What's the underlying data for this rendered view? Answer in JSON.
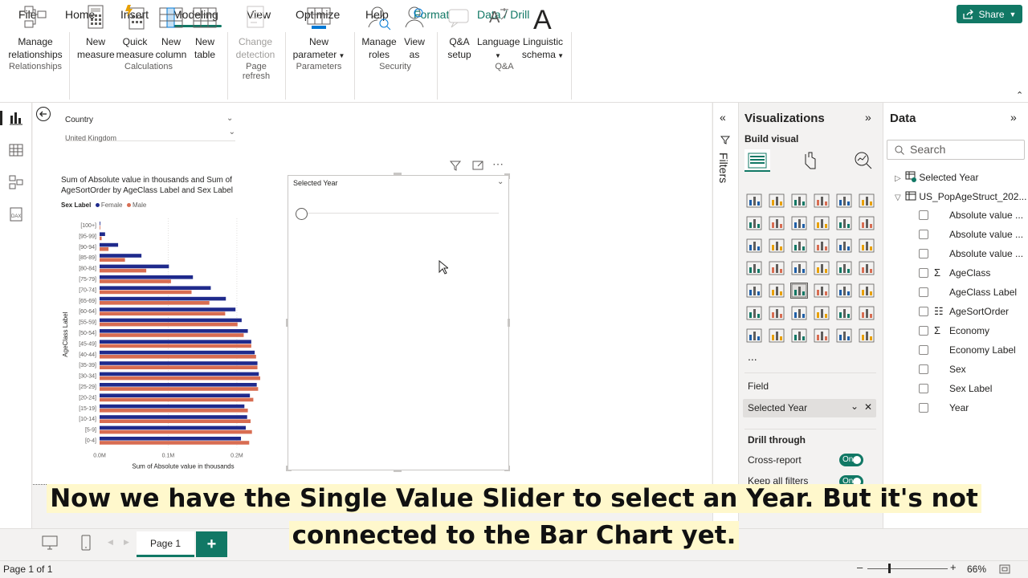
{
  "menu": {
    "items": [
      "File",
      "Home",
      "Insert",
      "Modeling",
      "View",
      "Optimize",
      "Help",
      "Format",
      "Data / Drill"
    ],
    "active": "Modeling",
    "share_label": "Share"
  },
  "ribbon": {
    "manage_relationships": "Manage relationships",
    "relationships_group": "Relationships",
    "new_measure": "New measure",
    "quick_measure": "Quick measure",
    "new_column": "New column",
    "new_table": "New table",
    "calculations_group": "Calculations",
    "change_detection": "Change detection",
    "page_refresh_group": "Page refresh",
    "new_parameter": "New parameter",
    "parameters_group": "Parameters",
    "manage_roles": "Manage roles",
    "view_as": "View as",
    "security_group": "Security",
    "qa_setup": "Q&A setup",
    "language": "Language",
    "linguistic_schema": "Linguistic schema",
    "qa_group": "Q&A"
  },
  "slicer_country": {
    "label": "Country",
    "value": "United Kingdom"
  },
  "slider_visual": {
    "title": "Selected Year"
  },
  "chart_data": {
    "type": "bar",
    "title": "Sum of Absolute value in thousands and Sum of AgeSortOrder by AgeClass Label and Sex Label",
    "legend_title": "Sex Label",
    "xlabel": "Sum of Absolute value in thousands",
    "ylabel": "AgeClass Label",
    "x_ticks": [
      "0.0M",
      "0.1M",
      "0.2M"
    ],
    "xlim": [
      0,
      0.22
    ],
    "categories": [
      "[100+]",
      "[95-99]",
      "[90-94]",
      "[85-89]",
      "[80-84]",
      "[75-79]",
      "[70-74]",
      "[65-69]",
      "[60-64]",
      "[55-59]",
      "[50-54]",
      "[45-49]",
      "[40-44]",
      "[35-39]",
      "[30-34]",
      "[25-29]",
      "[20-24]",
      "[15-19]",
      "[10-14]",
      "[5-9]",
      "[0-4]"
    ],
    "series": [
      {
        "name": "Female",
        "color": "#1f2a8c",
        "values": [
          0.001,
          0.008,
          0.027,
          0.061,
          0.101,
          0.136,
          0.162,
          0.184,
          0.198,
          0.207,
          0.216,
          0.221,
          0.226,
          0.23,
          0.232,
          0.229,
          0.219,
          0.211,
          0.215,
          0.213,
          0.206
        ]
      },
      {
        "name": "Male",
        "color": "#d86d52",
        "values": [
          0.0005,
          0.003,
          0.013,
          0.037,
          0.068,
          0.104,
          0.134,
          0.16,
          0.183,
          0.201,
          0.21,
          0.221,
          0.228,
          0.23,
          0.234,
          0.231,
          0.224,
          0.216,
          0.22,
          0.222,
          0.218
        ]
      }
    ]
  },
  "filters": {
    "label": "Filters"
  },
  "visualizations": {
    "title": "Visualizations",
    "build_visual": "Build visual",
    "more": "...",
    "field_label": "Field",
    "field_value": "Selected Year",
    "drill_through": "Drill through",
    "cross_report": "Cross-report",
    "keep_all_filters": "Keep all filters",
    "toggle_on": "On"
  },
  "data_pane": {
    "title": "Data",
    "search_placeholder": "Search",
    "tables": [
      {
        "name": "Selected Year"
      },
      {
        "name": "US_PopAgeStruct_202..."
      }
    ],
    "fields": [
      "Absolute value ...",
      "Absolute value ...",
      "Absolute value ...",
      "AgeClass",
      "AgeClass Label",
      "AgeSortOrder",
      "Economy",
      "Economy Label",
      "Sex",
      "Sex Label",
      "Year"
    ]
  },
  "pages": {
    "tab": "Page 1",
    "add": "+"
  },
  "status": {
    "page_info": "Page 1 of 1",
    "zoom": "66%"
  },
  "caption": {
    "line1": "Now we have the Single Value Slider to select an Year. But it's not",
    "line2": "connected to the Bar Chart yet."
  },
  "colors": {
    "accent": "#117865",
    "female": "#1f2a8c",
    "male": "#d86d52"
  }
}
